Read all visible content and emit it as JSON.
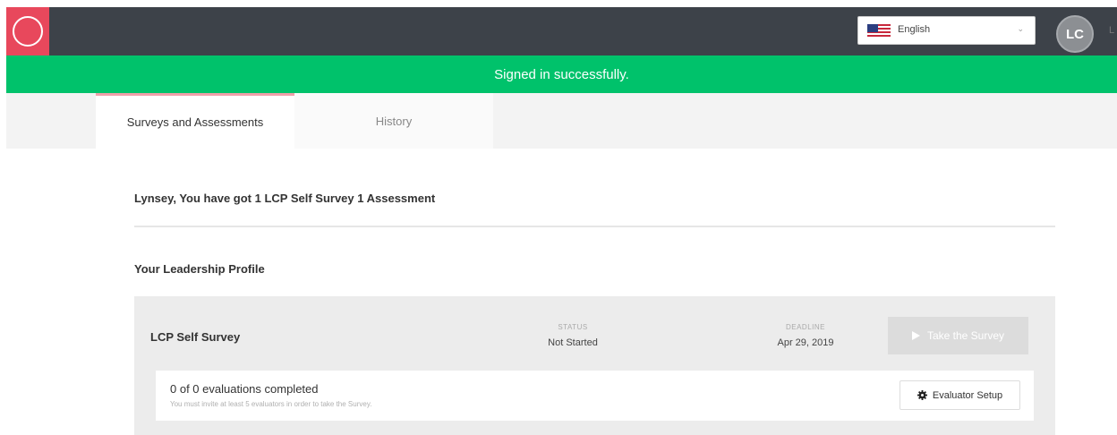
{
  "header": {
    "language": {
      "selected": "English",
      "caret": "⌄"
    },
    "user": {
      "initials": "LC",
      "extra": "L"
    }
  },
  "flash": {
    "message": "Signed in successfully."
  },
  "tabs": [
    {
      "label": "Surveys and Assessments",
      "active": true
    },
    {
      "label": "History",
      "active": false
    }
  ],
  "main": {
    "greeting": "Lynsey, You have got 1 LCP Self Survey 1 Assessment",
    "section_title": "Your Leadership Profile",
    "survey": {
      "name": "LCP Self Survey",
      "status_label": "STATUS",
      "status_value": "Not Started",
      "deadline_label": "DEADLINE",
      "deadline_value": "Apr 29, 2019",
      "take_button_label": "Take the Survey",
      "evaluations": {
        "count_text": "0 of 0 evaluations completed",
        "note": "You must invite at least 5 evaluators in order to take the Survey.",
        "setup_button_label": "Evaluator Setup"
      }
    }
  },
  "colors": {
    "topbar": "#3d4249",
    "logo": "#e8485c",
    "flash": "#00c26b",
    "tab_accent": "#f0a0aa"
  }
}
